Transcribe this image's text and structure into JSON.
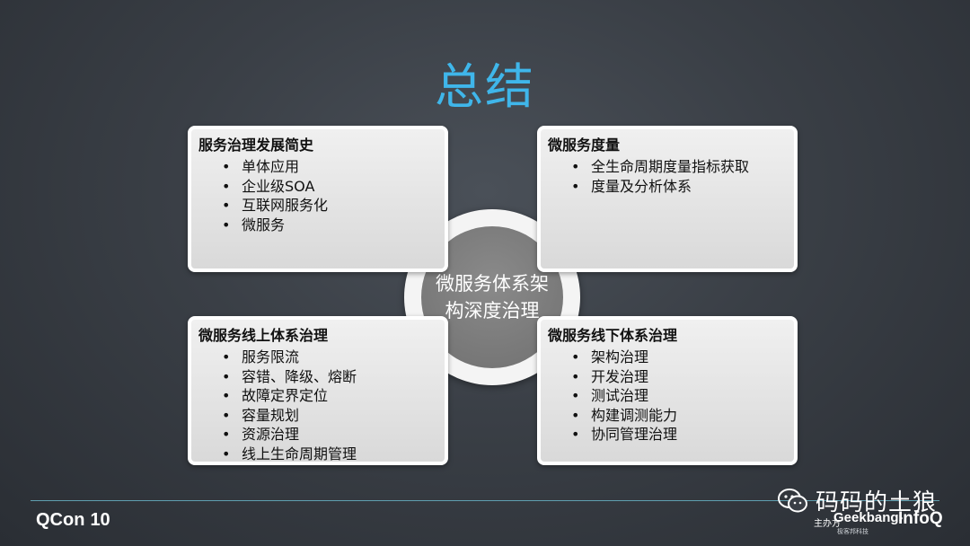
{
  "slide": {
    "title": "总结",
    "center": "微服务体系架构深度治理"
  },
  "cards": {
    "top_left": {
      "heading": "服务治理发展简史",
      "items": [
        "单体应用",
        "企业级SOA",
        "互联网服务化",
        "微服务"
      ]
    },
    "top_right": {
      "heading": "微服务度量",
      "items": [
        "全生命周期度量指标获取",
        "度量及分析体系"
      ]
    },
    "bottom_left": {
      "heading": "微服务线上体系治理",
      "items": [
        "服务限流",
        "容错、降级、熔断",
        "故障定界定位",
        "容量规划",
        "资源治理",
        "线上生命周期管理"
      ]
    },
    "bottom_right": {
      "heading": "微服务线下体系治理",
      "items": [
        "架构治理",
        "开发治理",
        "测试治理",
        "构建调测能力",
        "协同管理治理"
      ]
    }
  },
  "footer": {
    "brand": "QCon",
    "edition": "10",
    "watermark": "码码的土狼",
    "sponsor_label": "主办方",
    "geekbang": "Geekbang›.",
    "geekbang_sub": "极客邦科技",
    "infoq": "InfoQ"
  },
  "colors": {
    "title": "#3fb6ea",
    "hub": "#757575",
    "card_bg": "#e3e3e3"
  }
}
